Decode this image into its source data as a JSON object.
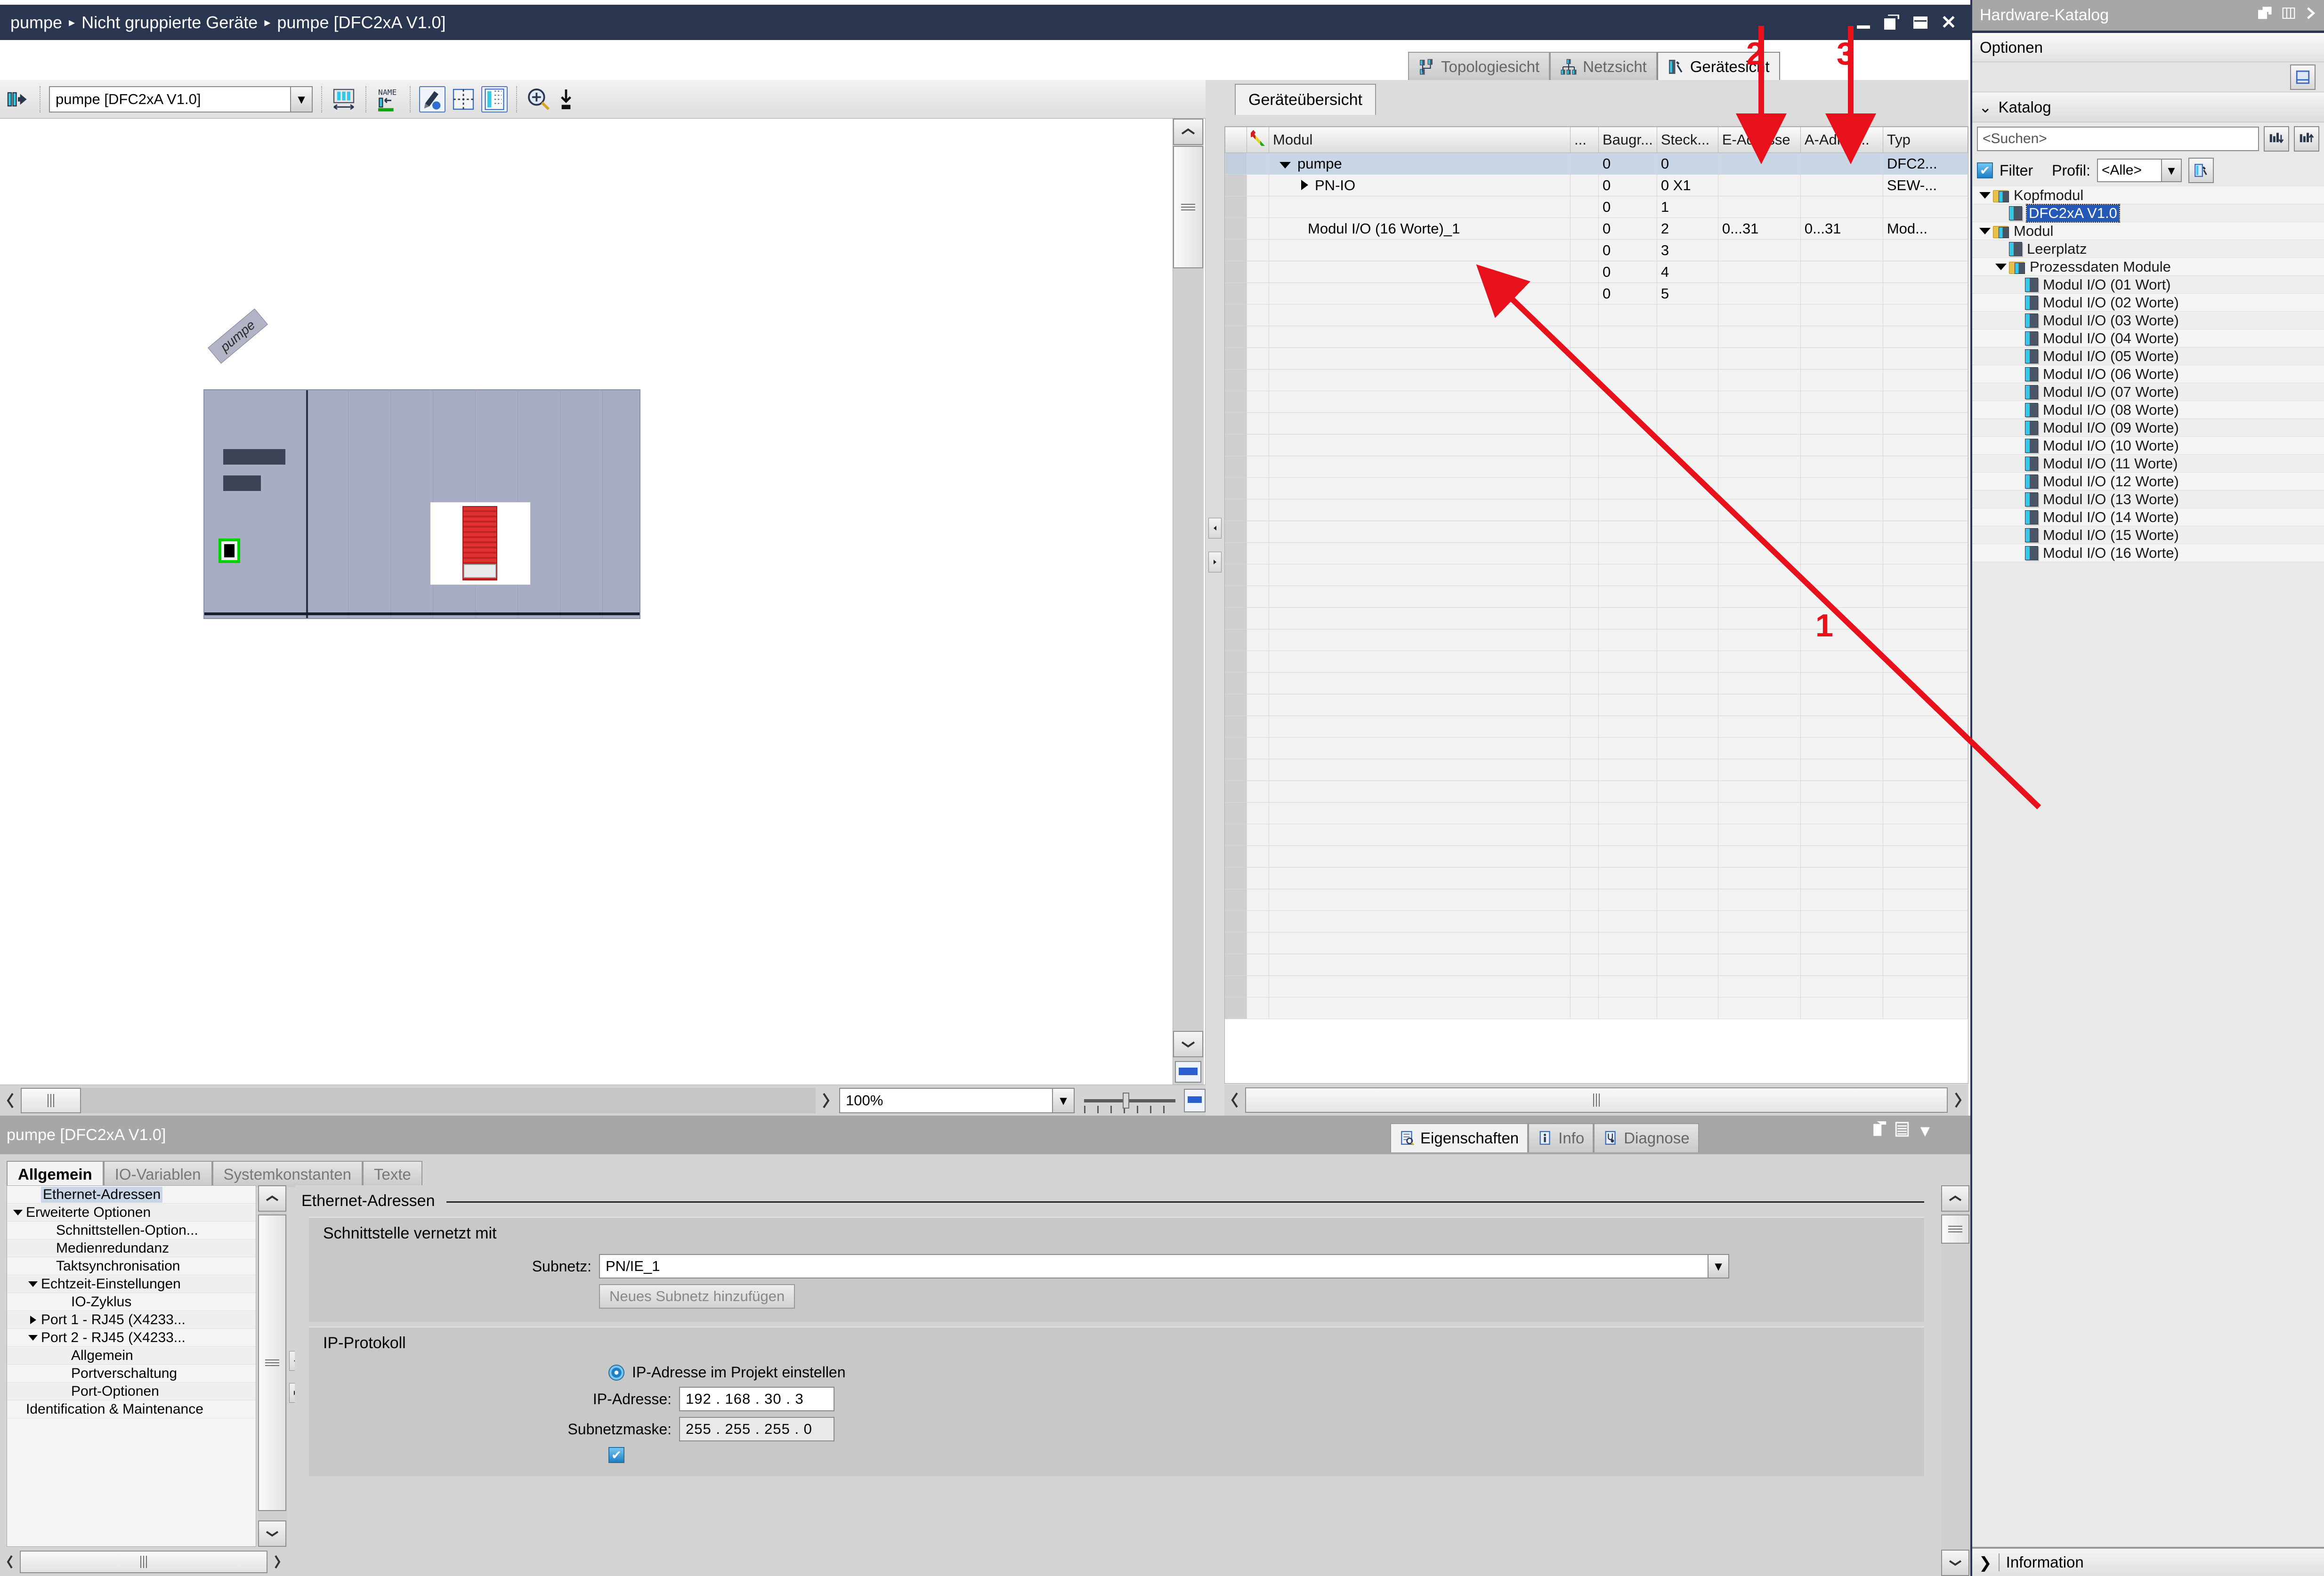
{
  "titlebar": {
    "breadcrumb": [
      "pumpe",
      "Nicht gruppierte Geräte",
      "pumpe [DFC2xA V1.0]"
    ],
    "separator": "▸",
    "buttons": [
      "minimize",
      "restore",
      "maximize",
      "close"
    ]
  },
  "view_tabs": [
    {
      "label": "Topologiesicht",
      "icon": "topology-icon",
      "active": false
    },
    {
      "label": "Netzsicht",
      "icon": "network-icon",
      "active": false
    },
    {
      "label": "Gerätesicht",
      "icon": "device-icon",
      "active": true
    }
  ],
  "workspace_toolbar": {
    "device_selector_value": "pumpe [DFC2xA V1.0]",
    "icons": [
      "jump-to-icon",
      "distribute-icon",
      "rename-icon",
      "edit-pencil-icon",
      "split-view-icon",
      "table-view-icon",
      "zoom-in-icon",
      "zoom-fit-icon"
    ]
  },
  "canvas": {
    "device_label": "pumpe",
    "zoom_value": "100%",
    "slots_visible": 8
  },
  "device_overview": {
    "tab_label": "Geräteübersicht",
    "columns": [
      "",
      "",
      "Modul",
      "...",
      "Baugr...",
      "Steck...",
      "E-Adresse",
      "A-Adres...",
      "Typ"
    ],
    "rows": [
      {
        "indent": 0,
        "expander": "down",
        "module": "pumpe",
        "dots": "",
        "rack": "0",
        "slot": "0",
        "in_addr": "",
        "out_addr": "",
        "type": "DFC2...",
        "selected": true
      },
      {
        "indent": 1,
        "expander": "right",
        "module": "PN-IO",
        "dots": "",
        "rack": "0",
        "slot": "0 X1",
        "in_addr": "",
        "out_addr": "",
        "type": "SEW-...",
        "selected": false
      },
      {
        "indent": 1,
        "expander": "none",
        "module": "",
        "dots": "",
        "rack": "0",
        "slot": "1",
        "in_addr": "",
        "out_addr": "",
        "type": "",
        "selected": false
      },
      {
        "indent": 1,
        "expander": "none",
        "module": "Modul I/O (16 Worte)_1",
        "dots": "",
        "rack": "0",
        "slot": "2",
        "in_addr": "0...31",
        "out_addr": "0...31",
        "type": "Mod...",
        "selected": false
      },
      {
        "indent": 1,
        "expander": "none",
        "module": "",
        "dots": "",
        "rack": "0",
        "slot": "3",
        "in_addr": "",
        "out_addr": "",
        "type": "",
        "selected": false
      },
      {
        "indent": 1,
        "expander": "none",
        "module": "",
        "dots": "",
        "rack": "0",
        "slot": "4",
        "in_addr": "",
        "out_addr": "",
        "type": "",
        "selected": false
      },
      {
        "indent": 1,
        "expander": "none",
        "module": "",
        "dots": "",
        "rack": "0",
        "slot": "5",
        "in_addr": "",
        "out_addr": "",
        "type": "",
        "selected": false
      }
    ],
    "empty_rows": 33
  },
  "catalog": {
    "title": "Hardware-Katalog",
    "options_label": "Optionen",
    "section_label": "Katalog",
    "search_placeholder": "<Suchen>",
    "search_value": "",
    "filter_label": "Filter",
    "filter_checked": true,
    "profile_label": "Profil:",
    "profile_value": "<Alle>",
    "information_label": "Information",
    "tree": [
      {
        "level": 0,
        "expander": "down",
        "icon": "folder-icon",
        "label": "Kopfmodul",
        "selected": false
      },
      {
        "level": 1,
        "expander": "none",
        "icon": "module-icon",
        "label": "DFC2xA V1.0",
        "selected": true
      },
      {
        "level": 0,
        "expander": "down",
        "icon": "folder-icon",
        "label": "Modul",
        "selected": false
      },
      {
        "level": 1,
        "expander": "none",
        "icon": "module-icon",
        "label": "Leerplatz",
        "selected": false
      },
      {
        "level": 1,
        "expander": "down",
        "icon": "folder-icon",
        "label": "Prozessdaten Module",
        "selected": false
      },
      {
        "level": 2,
        "expander": "none",
        "icon": "module-icon",
        "label": "Modul I/O (01 Wort)",
        "selected": false
      },
      {
        "level": 2,
        "expander": "none",
        "icon": "module-icon",
        "label": "Modul I/O (02 Worte)",
        "selected": false
      },
      {
        "level": 2,
        "expander": "none",
        "icon": "module-icon",
        "label": "Modul I/O (03 Worte)",
        "selected": false
      },
      {
        "level": 2,
        "expander": "none",
        "icon": "module-icon",
        "label": "Modul I/O (04 Worte)",
        "selected": false
      },
      {
        "level": 2,
        "expander": "none",
        "icon": "module-icon",
        "label": "Modul I/O (05 Worte)",
        "selected": false
      },
      {
        "level": 2,
        "expander": "none",
        "icon": "module-icon",
        "label": "Modul I/O (06 Worte)",
        "selected": false
      },
      {
        "level": 2,
        "expander": "none",
        "icon": "module-icon",
        "label": "Modul I/O (07 Worte)",
        "selected": false
      },
      {
        "level": 2,
        "expander": "none",
        "icon": "module-icon",
        "label": "Modul I/O (08 Worte)",
        "selected": false
      },
      {
        "level": 2,
        "expander": "none",
        "icon": "module-icon",
        "label": "Modul I/O (09 Worte)",
        "selected": false
      },
      {
        "level": 2,
        "expander": "none",
        "icon": "module-icon",
        "label": "Modul I/O (10 Worte)",
        "selected": false
      },
      {
        "level": 2,
        "expander": "none",
        "icon": "module-icon",
        "label": "Modul I/O (11 Worte)",
        "selected": false
      },
      {
        "level": 2,
        "expander": "none",
        "icon": "module-icon",
        "label": "Modul I/O (12 Worte)",
        "selected": false
      },
      {
        "level": 2,
        "expander": "none",
        "icon": "module-icon",
        "label": "Modul I/O (13 Worte)",
        "selected": false
      },
      {
        "level": 2,
        "expander": "none",
        "icon": "module-icon",
        "label": "Modul I/O (14 Worte)",
        "selected": false
      },
      {
        "level": 2,
        "expander": "none",
        "icon": "module-icon",
        "label": "Modul I/O (15 Worte)",
        "selected": false
      },
      {
        "level": 2,
        "expander": "none",
        "icon": "module-icon",
        "label": "Modul I/O (16 Worte)",
        "selected": false
      }
    ]
  },
  "properties": {
    "header_title": "pumpe [DFC2xA V1.0]",
    "panel_tabs": [
      {
        "label": "Eigenschaften",
        "icon": "properties-icon",
        "active": true
      },
      {
        "label": "Info",
        "icon": "info-icon",
        "active": false
      },
      {
        "label": "Diagnose",
        "icon": "diagnose-icon",
        "active": false
      }
    ],
    "category_tabs": [
      {
        "label": "Allgemein",
        "active": true
      },
      {
        "label": "IO-Variablen",
        "active": false
      },
      {
        "label": "Systemkonstanten",
        "active": false
      },
      {
        "label": "Texte",
        "active": false
      }
    ],
    "nav_tree": [
      {
        "level": 1,
        "expander": "none",
        "label": "Ethernet-Adressen",
        "selected": true
      },
      {
        "level": 0,
        "expander": "down",
        "label": "Erweiterte Optionen",
        "selected": false
      },
      {
        "level": 2,
        "expander": "none",
        "label": "Schnittstellen-Option...",
        "selected": false
      },
      {
        "level": 2,
        "expander": "none",
        "label": "Medienredundanz",
        "selected": false
      },
      {
        "level": 2,
        "expander": "none",
        "label": "Taktsynchronisation",
        "selected": false
      },
      {
        "level": 1,
        "expander": "down",
        "label": "Echtzeit-Einstellungen",
        "selected": false
      },
      {
        "level": 3,
        "expander": "none",
        "label": "IO-Zyklus",
        "selected": false
      },
      {
        "level": 1,
        "expander": "right",
        "label": "Port 1 - RJ45 (X4233...",
        "selected": false
      },
      {
        "level": 1,
        "expander": "down",
        "label": "Port 2 - RJ45 (X4233...",
        "selected": false
      },
      {
        "level": 3,
        "expander": "none",
        "label": "Allgemein",
        "selected": false
      },
      {
        "level": 3,
        "expander": "none",
        "label": "Portverschaltung",
        "selected": false
      },
      {
        "level": 3,
        "expander": "none",
        "label": "Port-Optionen",
        "selected": false
      },
      {
        "level": 0,
        "expander": "none",
        "label": "Identification & Maintenance",
        "selected": false
      }
    ],
    "content": {
      "page_title": "Ethernet-Adressen",
      "group1_title": "Schnittstelle vernetzt mit",
      "subnet_label": "Subnetz:",
      "subnet_value": "PN/IE_1",
      "add_subnet_button": "Neues Subnetz hinzufügen",
      "group2_title": "IP-Protokoll",
      "radio_project_label": "IP-Adresse im Projekt einstellen",
      "ip_label": "IP-Adresse:",
      "ip_value": "192 . 168 . 30  . 3",
      "mask_label": "Subnetzmaske:",
      "mask_value": "255 . 255 . 255 . 0"
    }
  },
  "annotations": {
    "color": "#e8101a",
    "markers": [
      {
        "id": "1",
        "target": "module-row-and-catalog-entry"
      },
      {
        "id": "2",
        "target": "e-adresse-column"
      },
      {
        "id": "3",
        "target": "a-adresse-column"
      }
    ]
  }
}
